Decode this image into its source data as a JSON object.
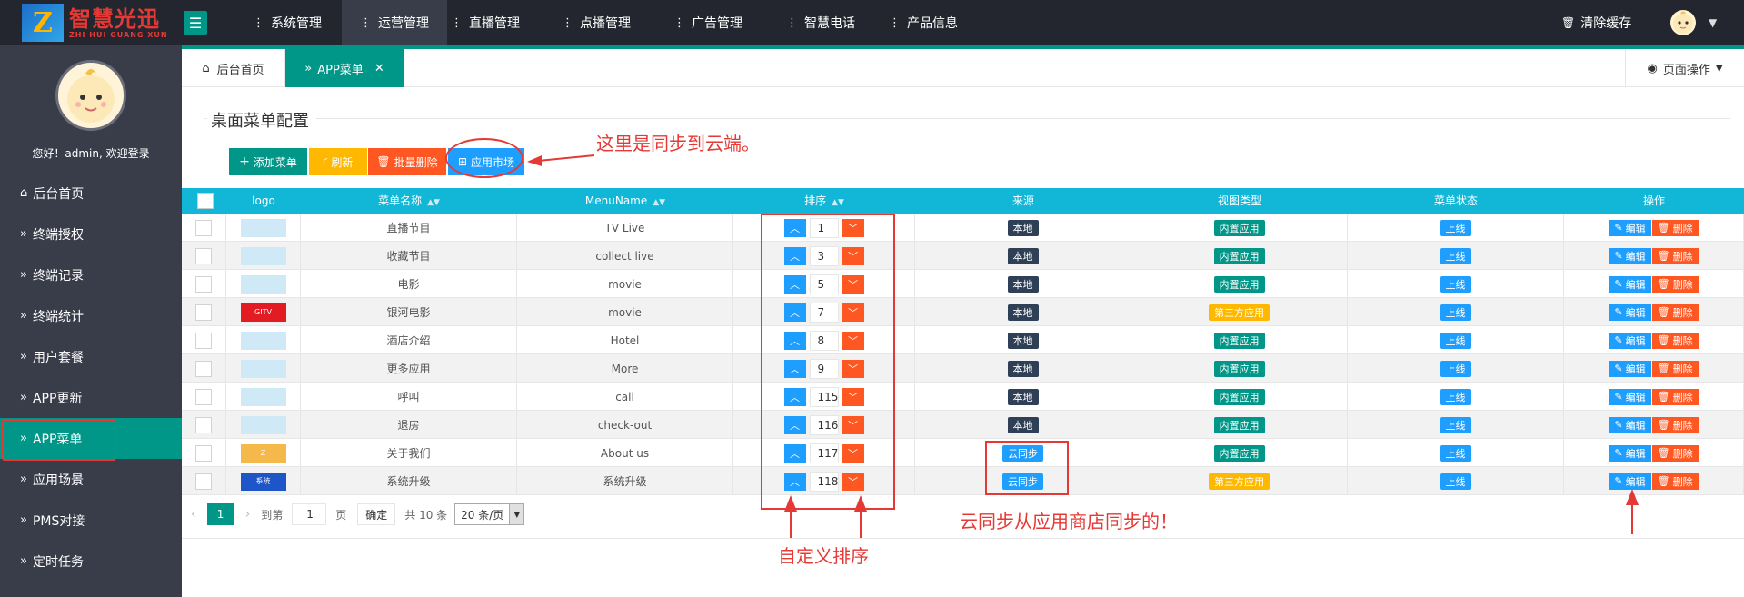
{
  "brand": {
    "name_cn": "智慧光迅",
    "name_en": "ZHI HUI GUANG XUN",
    "logo_letter": "Z"
  },
  "topnav": [
    {
      "label": "系统管理",
      "active": false
    },
    {
      "label": "运营管理",
      "active": true
    },
    {
      "label": "直播管理",
      "active": false
    },
    {
      "label": "点播管理",
      "active": false
    },
    {
      "label": "广告管理",
      "active": false
    },
    {
      "label": "智慧电话",
      "active": false
    },
    {
      "label": "产品信息",
      "active": false
    }
  ],
  "header": {
    "clear_cache": "清除缓存"
  },
  "sidebar": {
    "welcome": "您好！admin, 欢迎登录",
    "items": [
      {
        "label": "后台首页",
        "icon": "home-icon"
      },
      {
        "label": "终端授权",
        "icon": "double-chevron-icon"
      },
      {
        "label": "终端记录",
        "icon": "double-chevron-icon"
      },
      {
        "label": "终端统计",
        "icon": "double-chevron-icon"
      },
      {
        "label": "用户套餐",
        "icon": "double-chevron-icon"
      },
      {
        "label": "APP更新",
        "icon": "double-chevron-icon"
      },
      {
        "label": "APP菜单",
        "icon": "double-chevron-icon",
        "active": true
      },
      {
        "label": "应用场景",
        "icon": "double-chevron-icon"
      },
      {
        "label": "PMS对接",
        "icon": "double-chevron-icon"
      },
      {
        "label": "定时任务",
        "icon": "double-chevron-icon"
      }
    ]
  },
  "tabs": {
    "home": "后台首页",
    "current": "APP菜单",
    "page_ops": "页面操作"
  },
  "section_title": "桌面菜单配置",
  "toolbar": {
    "add": "添加菜单",
    "refresh": "刷新",
    "batch_delete": "批量删除",
    "app_market": "应用市场"
  },
  "annotations": {
    "sync_note": "这里是同步到云端。",
    "custom_order": "自定义排序",
    "cloud_sync_note": "云同步从应用商店同步的！"
  },
  "table": {
    "headers": {
      "logo": "logo",
      "name": "菜单名称",
      "menuname": "MenuName",
      "order": "排序",
      "source": "来源",
      "view_type": "视图类型",
      "status": "菜单状态",
      "ops": "操作"
    },
    "edit_label": "编辑",
    "delete_label": "删除",
    "rows": [
      {
        "name": "直播节目",
        "menuname": "TV Live",
        "order": "1",
        "source": "本地",
        "view_type": "内置应用",
        "status": "上线",
        "logo_color": "#cfe9f7",
        "logo_text": ""
      },
      {
        "name": "收藏节目",
        "menuname": "collect live",
        "order": "3",
        "source": "本地",
        "view_type": "内置应用",
        "status": "上线",
        "logo_color": "#cfe9f7",
        "logo_text": ""
      },
      {
        "name": "电影",
        "menuname": "movie",
        "order": "5",
        "source": "本地",
        "view_type": "内置应用",
        "status": "上线",
        "logo_color": "#cfe9f7",
        "logo_text": ""
      },
      {
        "name": "银河电影",
        "menuname": "movie",
        "order": "7",
        "source": "本地",
        "view_type": "第三方应用",
        "status": "上线",
        "logo_color": "#e31b23",
        "logo_text": "GITV"
      },
      {
        "name": "酒店介绍",
        "menuname": "Hotel",
        "order": "8",
        "source": "本地",
        "view_type": "内置应用",
        "status": "上线",
        "logo_color": "#cfe9f7",
        "logo_text": ""
      },
      {
        "name": "更多应用",
        "menuname": "More",
        "order": "9",
        "source": "本地",
        "view_type": "内置应用",
        "status": "上线",
        "logo_color": "#cfe9f7",
        "logo_text": ""
      },
      {
        "name": "呼叫",
        "menuname": "call",
        "order": "115",
        "source": "本地",
        "view_type": "内置应用",
        "status": "上线",
        "logo_color": "#cfe9f7",
        "logo_text": ""
      },
      {
        "name": "退房",
        "menuname": "check-out",
        "order": "116",
        "source": "本地",
        "view_type": "内置应用",
        "status": "上线",
        "logo_color": "#cfe9f7",
        "logo_text": ""
      },
      {
        "name": "关于我们",
        "menuname": "About us",
        "order": "117",
        "source": "云同步",
        "view_type": "内置应用",
        "status": "上线",
        "logo_color": "#f5b84a",
        "logo_text": "Z"
      },
      {
        "name": "系统升级",
        "menuname": "系统升级",
        "order": "118",
        "source": "云同步",
        "view_type": "第三方应用",
        "status": "上线",
        "logo_color": "#1e56c8",
        "logo_text": "系统"
      }
    ]
  },
  "pager": {
    "current": "1",
    "goto": "到第",
    "page_input": "1",
    "page_unit": "页",
    "confirm": "确定",
    "total": "共 10 条",
    "per_page": "20 条/页"
  },
  "colors": {
    "accent": "#009688",
    "header_bg": "#23262e",
    "sidebar_bg": "#393d49",
    "table_head": "#12b7d8",
    "annotation": "#e53935"
  }
}
